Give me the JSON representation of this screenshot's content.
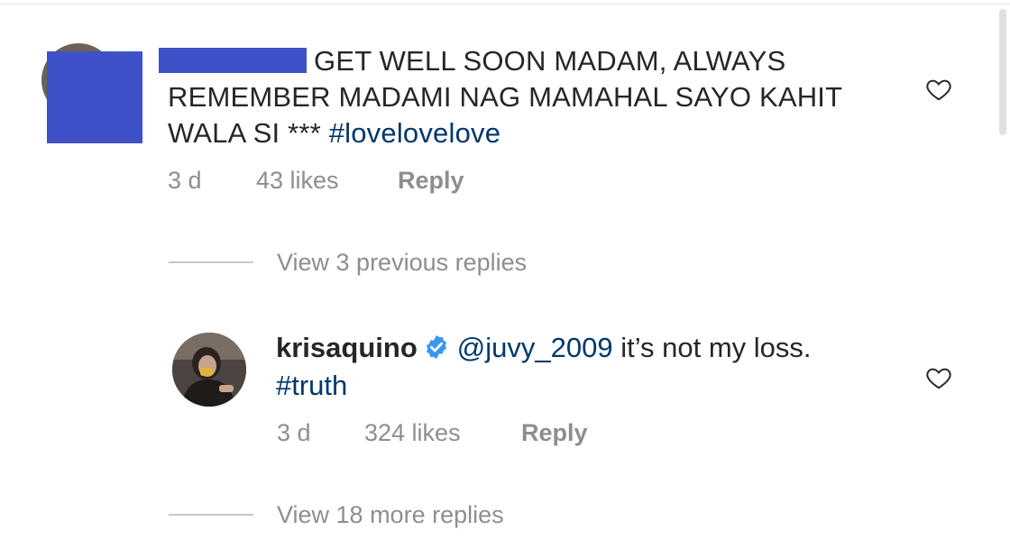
{
  "comment1": {
    "text_line1": "GET WELL SOON MADAM, ALWAYS",
    "text_line2": "REMEMBER MADAMI NAG MAMAHAL SAYO KAHIT",
    "text_line3_plain": "WALA SI *** ",
    "hashtag": "#lovelovelove",
    "time": "3 d",
    "likes": "43 likes",
    "reply": "Reply",
    "view_replies": "View 3 previous replies"
  },
  "comment2": {
    "username": "krisaquino",
    "mention": "@juvy_2009",
    "text": " it’s not my loss.",
    "hashtag": "#truth",
    "time": "3 d",
    "likes": "324 likes",
    "reply": "Reply",
    "view_replies": "View 18 more replies"
  },
  "colors": {
    "text": "#262626",
    "secondary": "#8e8e8e",
    "link": "#00376b",
    "verified": "#3897f0",
    "redaction": "#3f51c8"
  },
  "icons": {
    "like": "heart-outline-icon",
    "verified": "verified-badge-icon"
  }
}
